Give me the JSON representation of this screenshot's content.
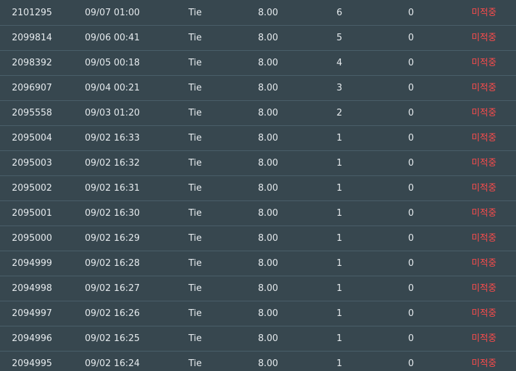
{
  "colors": {
    "background": "#37474f",
    "row_divider": "#4a5f6a",
    "text": "#e6ebee",
    "status_red": "#ff4b4b"
  },
  "rows": [
    {
      "id": "2101295",
      "time": "09/07 01:00",
      "pick": "Tie",
      "odds": "8.00",
      "count": "6",
      "amount": "0",
      "status": "미적중"
    },
    {
      "id": "2099814",
      "time": "09/06 00:41",
      "pick": "Tie",
      "odds": "8.00",
      "count": "5",
      "amount": "0",
      "status": "미적중"
    },
    {
      "id": "2098392",
      "time": "09/05 00:18",
      "pick": "Tie",
      "odds": "8.00",
      "count": "4",
      "amount": "0",
      "status": "미적중"
    },
    {
      "id": "2096907",
      "time": "09/04 00:21",
      "pick": "Tie",
      "odds": "8.00",
      "count": "3",
      "amount": "0",
      "status": "미적중"
    },
    {
      "id": "2095558",
      "time": "09/03 01:20",
      "pick": "Tie",
      "odds": "8.00",
      "count": "2",
      "amount": "0",
      "status": "미적중"
    },
    {
      "id": "2095004",
      "time": "09/02 16:33",
      "pick": "Tie",
      "odds": "8.00",
      "count": "1",
      "amount": "0",
      "status": "미적중"
    },
    {
      "id": "2095003",
      "time": "09/02 16:32",
      "pick": "Tie",
      "odds": "8.00",
      "count": "1",
      "amount": "0",
      "status": "미적중"
    },
    {
      "id": "2095002",
      "time": "09/02 16:31",
      "pick": "Tie",
      "odds": "8.00",
      "count": "1",
      "amount": "0",
      "status": "미적중"
    },
    {
      "id": "2095001",
      "time": "09/02 16:30",
      "pick": "Tie",
      "odds": "8.00",
      "count": "1",
      "amount": "0",
      "status": "미적중"
    },
    {
      "id": "2095000",
      "time": "09/02 16:29",
      "pick": "Tie",
      "odds": "8.00",
      "count": "1",
      "amount": "0",
      "status": "미적중"
    },
    {
      "id": "2094999",
      "time": "09/02 16:28",
      "pick": "Tie",
      "odds": "8.00",
      "count": "1",
      "amount": "0",
      "status": "미적중"
    },
    {
      "id": "2094998",
      "time": "09/02 16:27",
      "pick": "Tie",
      "odds": "8.00",
      "count": "1",
      "amount": "0",
      "status": "미적중"
    },
    {
      "id": "2094997",
      "time": "09/02 16:26",
      "pick": "Tie",
      "odds": "8.00",
      "count": "1",
      "amount": "0",
      "status": "미적중"
    },
    {
      "id": "2094996",
      "time": "09/02 16:25",
      "pick": "Tie",
      "odds": "8.00",
      "count": "1",
      "amount": "0",
      "status": "미적중"
    },
    {
      "id": "2094995",
      "time": "09/02 16:24",
      "pick": "Tie",
      "odds": "8.00",
      "count": "1",
      "amount": "0",
      "status": "미적중"
    }
  ]
}
